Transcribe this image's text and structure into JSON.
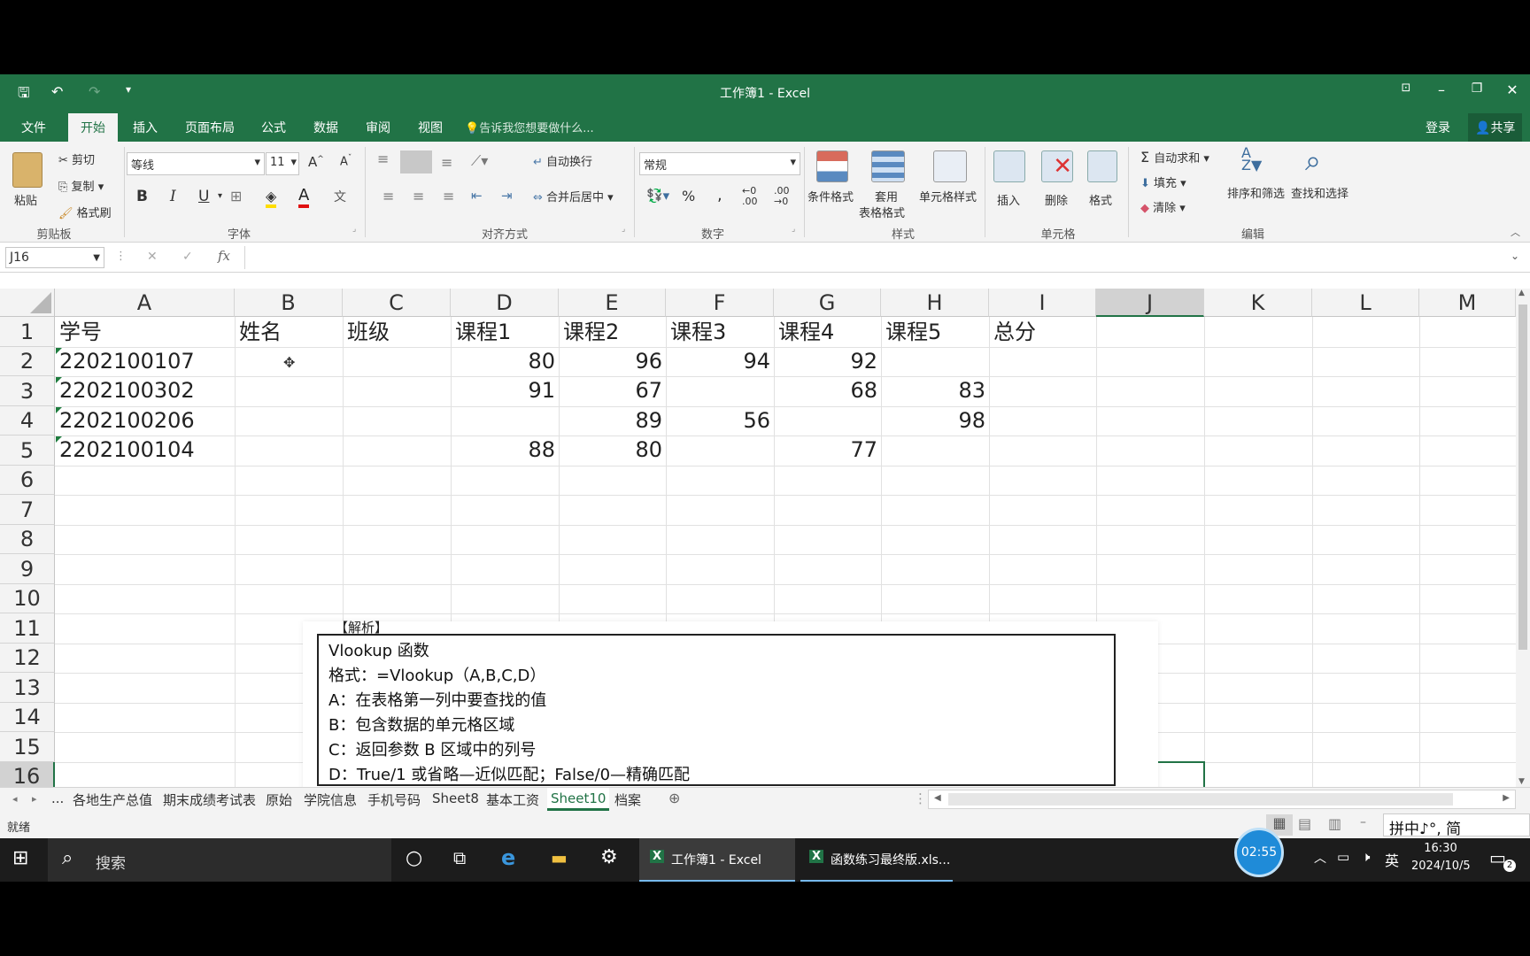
{
  "window": {
    "title": "工作簿1 - Excel"
  },
  "ribbon_tabs": [
    "文件",
    "开始",
    "插入",
    "页面布局",
    "公式",
    "数据",
    "审阅",
    "视图"
  ],
  "tell_me": "告诉我您想要做什么...",
  "account": {
    "login": "登录",
    "share": "共享"
  },
  "clipboard": {
    "paste": "粘贴",
    "cut": "剪切",
    "copy": "复制",
    "format_painter": "格式刷",
    "label": "剪贴板"
  },
  "font": {
    "name": "等线",
    "size": "11",
    "label": "字体"
  },
  "alignment": {
    "wrap": "自动换行",
    "merge": "合并后居中",
    "label": "对齐方式"
  },
  "number": {
    "format": "常规",
    "label": "数字"
  },
  "styles": {
    "conditional": "条件格式",
    "table_format_1": "套用",
    "table_format_2": "表格格式",
    "cell_styles": "单元格样式",
    "label": "样式"
  },
  "cells": {
    "insert": "插入",
    "delete": "删除",
    "format": "格式",
    "label": "单元格"
  },
  "editing": {
    "autosum": "自动求和",
    "fill": "填充",
    "clear": "清除",
    "sort_filter": "排序和筛选",
    "find_select": "查找和选择",
    "label": "编辑"
  },
  "formula_bar": {
    "name_box": "J16",
    "fx": "fx",
    "formula": ""
  },
  "columns": [
    "A",
    "B",
    "C",
    "D",
    "E",
    "F",
    "G",
    "H",
    "I",
    "J",
    "K",
    "L",
    "M"
  ],
  "rows": [
    "1",
    "2",
    "3",
    "4",
    "5",
    "6",
    "7",
    "8",
    "9",
    "10",
    "11",
    "12",
    "13",
    "14",
    "15",
    "16"
  ],
  "sheet": {
    "headers": [
      "学号",
      "姓名",
      "班级",
      "课程1",
      "课程2",
      "课程3",
      "课程4",
      "课程5",
      "总分"
    ],
    "data": [
      {
        "id": "2202100107",
        "d": "80",
        "e": "96",
        "f": "94",
        "g": "92",
        "h": ""
      },
      {
        "id": "2202100302",
        "d": "91",
        "e": "67",
        "f": "",
        "g": "68",
        "h": "83"
      },
      {
        "id": "2202100206",
        "d": "",
        "e": "89",
        "f": "56",
        "g": "",
        "h": "98"
      },
      {
        "id": "2202100104",
        "d": "88",
        "e": "80",
        "f": "",
        "g": "77",
        "h": ""
      }
    ]
  },
  "overlay": {
    "heading": "【解析】",
    "lines": [
      "Vlookup 函数",
      "格式：=Vlookup（A,B,C,D）",
      "A：在表格第一列中要查找的值",
      "B：包含数据的单元格区域",
      "C：返回参数 B 区域中的列号",
      "D：True/1 或省略—近似匹配；False/0—精确匹配"
    ]
  },
  "sheet_tabs": [
    "...",
    "各地生产总值",
    "期末成绩考试表",
    "原始",
    "学院信息",
    "手机号码",
    "Sheet8",
    "基本工资",
    "Sheet10",
    "档案"
  ],
  "active_sheet": "Sheet10",
  "status": {
    "ready": "就绪"
  },
  "ime": "拼中♪°, 简",
  "taskbar": {
    "search": "搜索",
    "apps": [
      "工作簿1 - Excel",
      "函数练习最终版.xls..."
    ],
    "timer": "02:55",
    "lang": "英",
    "time": "16:30",
    "date": "2024/10/5",
    "notifications": "2"
  },
  "colors": {
    "excel_green": "#217346",
    "taskbar": "#1c1c1c",
    "active_tab_text": "#217346"
  }
}
